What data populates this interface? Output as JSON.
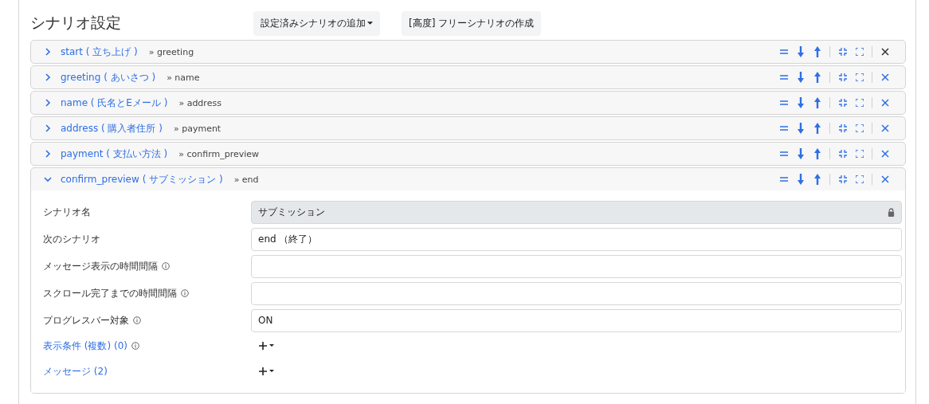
{
  "title": "シナリオ設定",
  "header_buttons": [
    {
      "label": "設定済みシナリオの追加",
      "dropdown": true
    },
    {
      "label": "[高度] フリーシナリオの作成",
      "dropdown": false
    }
  ],
  "scenarios": [
    {
      "name": "start ( 立ち上げ )",
      "next": "» greeting",
      "expanded": false,
      "close_hovered": true
    },
    {
      "name": "greeting ( あいさつ )",
      "next": "» name",
      "expanded": false,
      "close_hovered": false
    },
    {
      "name": "name ( 氏名とEメール )",
      "next": "» address",
      "expanded": false,
      "close_hovered": false
    },
    {
      "name": "address ( 購入者住所 )",
      "next": "» payment",
      "expanded": false,
      "close_hovered": false
    },
    {
      "name": "payment ( 支払い方法 )",
      "next": "» confirm_preview",
      "expanded": false,
      "close_hovered": false
    },
    {
      "name": "confirm_preview ( サブミッション )",
      "next": "» end",
      "expanded": true,
      "close_hovered": false
    }
  ],
  "fields": [
    {
      "kind": "input",
      "label": "シナリオ名",
      "info": false,
      "value": "サブミッション",
      "disabled": true
    },
    {
      "kind": "input",
      "label": "次のシナリオ",
      "info": false,
      "value": "end （終了）",
      "disabled": false
    },
    {
      "kind": "input",
      "label": "メッセージ表示の時間間隔",
      "info": true,
      "disabled": false
    },
    {
      "kind": "input",
      "label": "スクロール完了までの時間間隔",
      "info": true,
      "disabled": false
    },
    {
      "kind": "input",
      "label": "プログレスバー対象",
      "info": true,
      "value": "ON",
      "disabled": false
    },
    {
      "kind": "add",
      "label": "表示条件 (複数) (0)",
      "info": true
    },
    {
      "kind": "add",
      "label": "メッセージ (2)",
      "info": false
    }
  ]
}
